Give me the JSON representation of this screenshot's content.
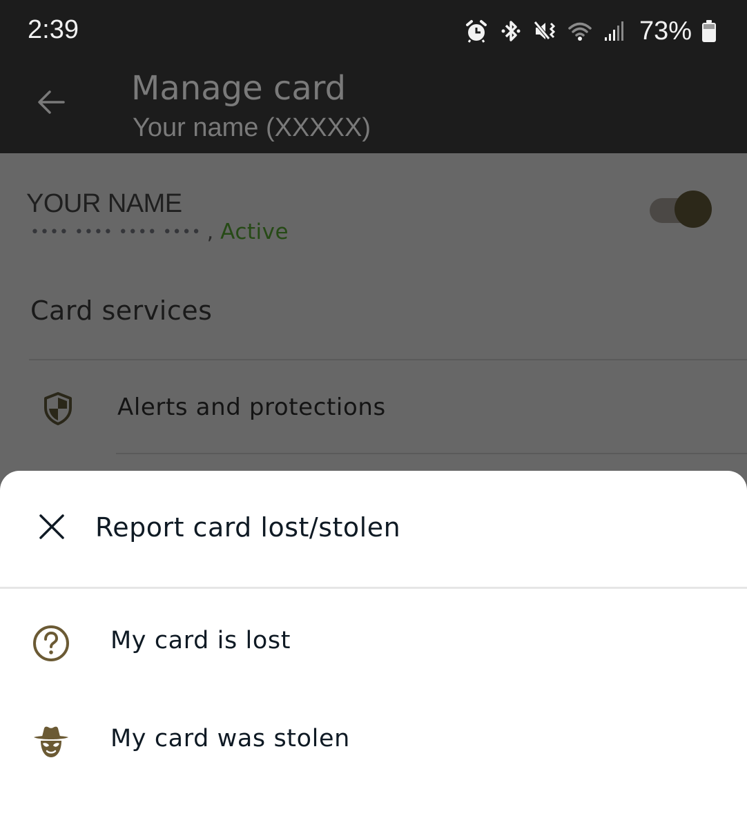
{
  "status_bar": {
    "time": "2:39",
    "icons": [
      "alarm-icon",
      "bluetooth-icon",
      "vibrate-mute-icon",
      "wifi-icon",
      "signal-icon"
    ],
    "battery_percent": "73%"
  },
  "app_bar": {
    "back_icon": "arrow-left-icon",
    "title": "Manage card",
    "subtitle": "Your name (XXXXX)"
  },
  "card": {
    "holder_name": "YOUR NAME",
    "masked_number": "•••• •••• ••••  ••••",
    "separator": ",",
    "status": "Active",
    "status_color": "#264a16",
    "toggle_on": true
  },
  "card_services": {
    "title": "Card services",
    "items": [
      {
        "icon": "shield-icon",
        "label": "Alerts and protections"
      }
    ]
  },
  "sheet": {
    "close_icon": "close-icon",
    "title": "Report card lost/stolen",
    "options": [
      {
        "icon": "question-circle-icon",
        "label": "My card is lost"
      },
      {
        "icon": "incognito-spy-icon",
        "label": "My card was stolen"
      }
    ],
    "accent_color": "#6b5a34"
  }
}
